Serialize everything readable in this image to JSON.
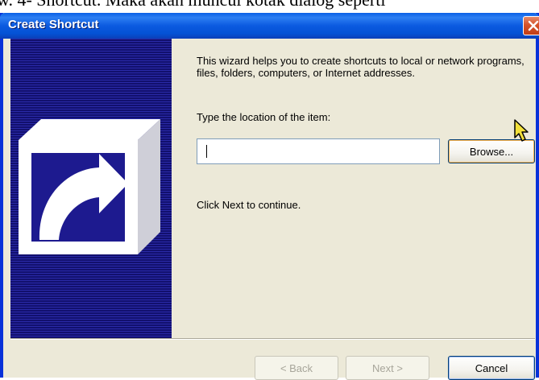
{
  "doc_text": "w. 4- Shortcut. Maka akan muncul kotak dialog seperti",
  "dialog": {
    "title": "Create Shortcut",
    "intro": "This wizard helps you to create shortcuts to local or network programs, files, folders, computers, or Internet addresses.",
    "location_label": "Type the location of the item:",
    "location_value": "",
    "browse_label": "Browse...",
    "continue_text": "Click Next to continue.",
    "back_label": "< Back",
    "next_label": "Next >",
    "cancel_label": "Cancel"
  },
  "icons": {
    "close": "close-icon",
    "wizard": "shortcut-arrow-icon",
    "cursor": "mouse-pointer-icon"
  },
  "colors": {
    "titlebar": "#0a5fe6",
    "panel": "#1d1a8f",
    "dialog_bg": "#ece9d8",
    "close": "#d5532a"
  }
}
